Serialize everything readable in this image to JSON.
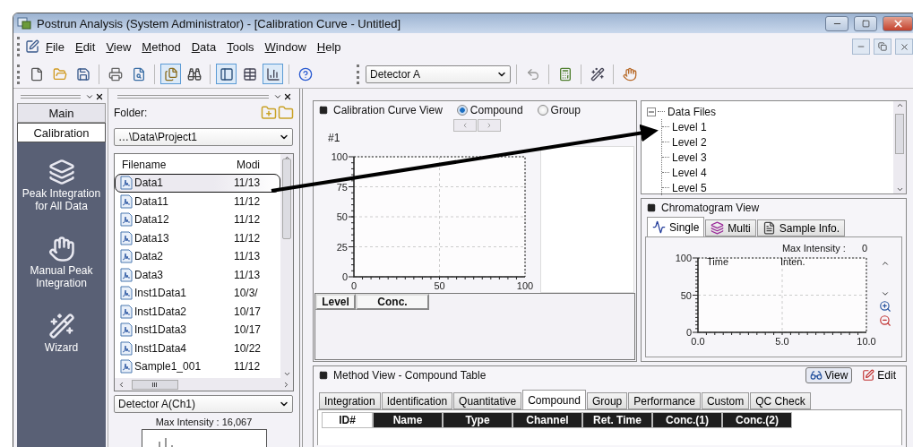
{
  "window": {
    "title": "Postrun Analysis (System Administrator) - [Calibration Curve - Untitled]"
  },
  "menu": [
    {
      "label": "File"
    },
    {
      "label": "Edit"
    },
    {
      "label": "View"
    },
    {
      "label": "Method"
    },
    {
      "label": "Data"
    },
    {
      "label": "Tools"
    },
    {
      "label": "Window"
    },
    {
      "label": "Help"
    }
  ],
  "toolbar": {
    "buttons_left": [
      {
        "kind": "new",
        "pressed": false
      },
      {
        "kind": "open",
        "pressed": false
      },
      {
        "kind": "save",
        "pressed": false
      },
      {
        "kind": "sep"
      },
      {
        "kind": "print",
        "pressed": false
      },
      {
        "kind": "preview",
        "pressed": false
      },
      {
        "kind": "sep"
      },
      {
        "kind": "files",
        "pressed": true
      },
      {
        "kind": "binoculars",
        "pressed": false
      },
      {
        "kind": "sep"
      },
      {
        "kind": "panel",
        "pressed": true
      },
      {
        "kind": "table",
        "pressed": false
      },
      {
        "kind": "chart",
        "pressed": true
      },
      {
        "kind": "sep"
      },
      {
        "kind": "help",
        "pressed": false
      }
    ],
    "detector": "Detector A",
    "buttons_right": [
      {
        "kind": "undo",
        "pressed": false
      },
      {
        "kind": "sep"
      },
      {
        "kind": "calc",
        "pressed": false
      },
      {
        "kind": "sep"
      },
      {
        "kind": "wizard",
        "pressed": false
      },
      {
        "kind": "sep"
      },
      {
        "kind": "hand",
        "pressed": false
      }
    ]
  },
  "sidebar": {
    "tabs": [
      {
        "label": "Main",
        "selected": false
      },
      {
        "label": "Calibration",
        "selected": true
      }
    ],
    "items": [
      {
        "kind": "batch",
        "label": "Peak Integration for All Data"
      },
      {
        "kind": "manual",
        "label": "Manual Peak Integration"
      },
      {
        "kind": "wizard",
        "label": "Wizard"
      }
    ]
  },
  "file_panel": {
    "folder_label": "Folder:",
    "folder": "…\\Data\\Project1",
    "columns": [
      "Filename",
      "Modi"
    ],
    "rows": [
      {
        "name": "Data1",
        "modified": "11/13",
        "selected": true
      },
      {
        "name": "Data11",
        "modified": "11/12",
        "selected": false
      },
      {
        "name": "Data12",
        "modified": "11/12",
        "selected": false
      },
      {
        "name": "Data13",
        "modified": "11/12",
        "selected": false
      },
      {
        "name": "Data2",
        "modified": "11/13",
        "selected": false
      },
      {
        "name": "Data3",
        "modified": "11/13",
        "selected": false
      },
      {
        "name": "Inst1Data1",
        "modified": "10/3/",
        "selected": false
      },
      {
        "name": "Inst1Data2",
        "modified": "10/17",
        "selected": false
      },
      {
        "name": "Inst1Data3",
        "modified": "10/17",
        "selected": false
      },
      {
        "name": "Inst1Data4",
        "modified": "10/22",
        "selected": false
      },
      {
        "name": "Sample1_001",
        "modified": "11/12",
        "selected": false
      }
    ],
    "scroll_label": "III",
    "detector": "Detector A(Ch1)",
    "max_intensity": "Max Intensity :  16,067"
  },
  "calibration_view": {
    "title": "Calibration Curve View",
    "options": [
      {
        "label": "Compound",
        "selected": true
      },
      {
        "label": "Group",
        "selected": false
      }
    ],
    "compound": "#1",
    "chart_data": {
      "type": "line",
      "grid": true,
      "xlim": [
        0,
        100
      ],
      "ylim": [
        0,
        100
      ],
      "xticks": [
        0,
        50,
        100
      ],
      "yticks": [
        0,
        25,
        50,
        75,
        100
      ]
    },
    "columns": [
      "Level",
      "Conc."
    ]
  },
  "data_files": {
    "label": "Data Files",
    "expanded": true,
    "children": [
      {
        "label": "Level 1"
      },
      {
        "label": "Level 2"
      },
      {
        "label": "Level 3"
      },
      {
        "label": "Level 4"
      },
      {
        "label": "Level 5"
      }
    ]
  },
  "chromatogram_view": {
    "title": "Chromatogram View",
    "tabs": [
      {
        "kind": "single",
        "label": "Single",
        "selected": true
      },
      {
        "kind": "multi",
        "label": "Multi",
        "selected": false
      },
      {
        "kind": "info",
        "label": "Sample Info.",
        "selected": false
      }
    ],
    "max_intensity_label": "Max Intensity :",
    "max_intensity": "0",
    "columns": [
      "Time",
      "Inten."
    ],
    "chart_data": {
      "type": "line",
      "grid": true,
      "xlim": [
        0,
        10
      ],
      "ylim": [
        0,
        100
      ],
      "xticks": [
        {
          "value": 0,
          "label": "0.0"
        },
        {
          "value": 5,
          "label": "5.0"
        },
        {
          "value": 10,
          "label": "10.0"
        }
      ],
      "yticks": [
        0,
        50,
        100
      ]
    }
  },
  "method_view": {
    "title": "Method View - Compound Table",
    "view_button": {
      "label": "View",
      "pressed": true
    },
    "edit_button": {
      "label": "Edit",
      "pressed": false
    },
    "tabs": [
      {
        "label": "Integration",
        "selected": false
      },
      {
        "label": "Identification",
        "selected": false
      },
      {
        "label": "Quantitative",
        "selected": false
      },
      {
        "label": "Compound",
        "selected": true
      },
      {
        "label": "Group",
        "selected": false
      },
      {
        "label": "Performance",
        "selected": false
      },
      {
        "label": "Custom",
        "selected": false
      },
      {
        "label": "QC Check",
        "selected": false
      }
    ],
    "columns": [
      "ID#",
      "Name",
      "Type",
      "Channel",
      "Ret. Time",
      "Conc.(1)",
      "Conc.(2)"
    ]
  }
}
